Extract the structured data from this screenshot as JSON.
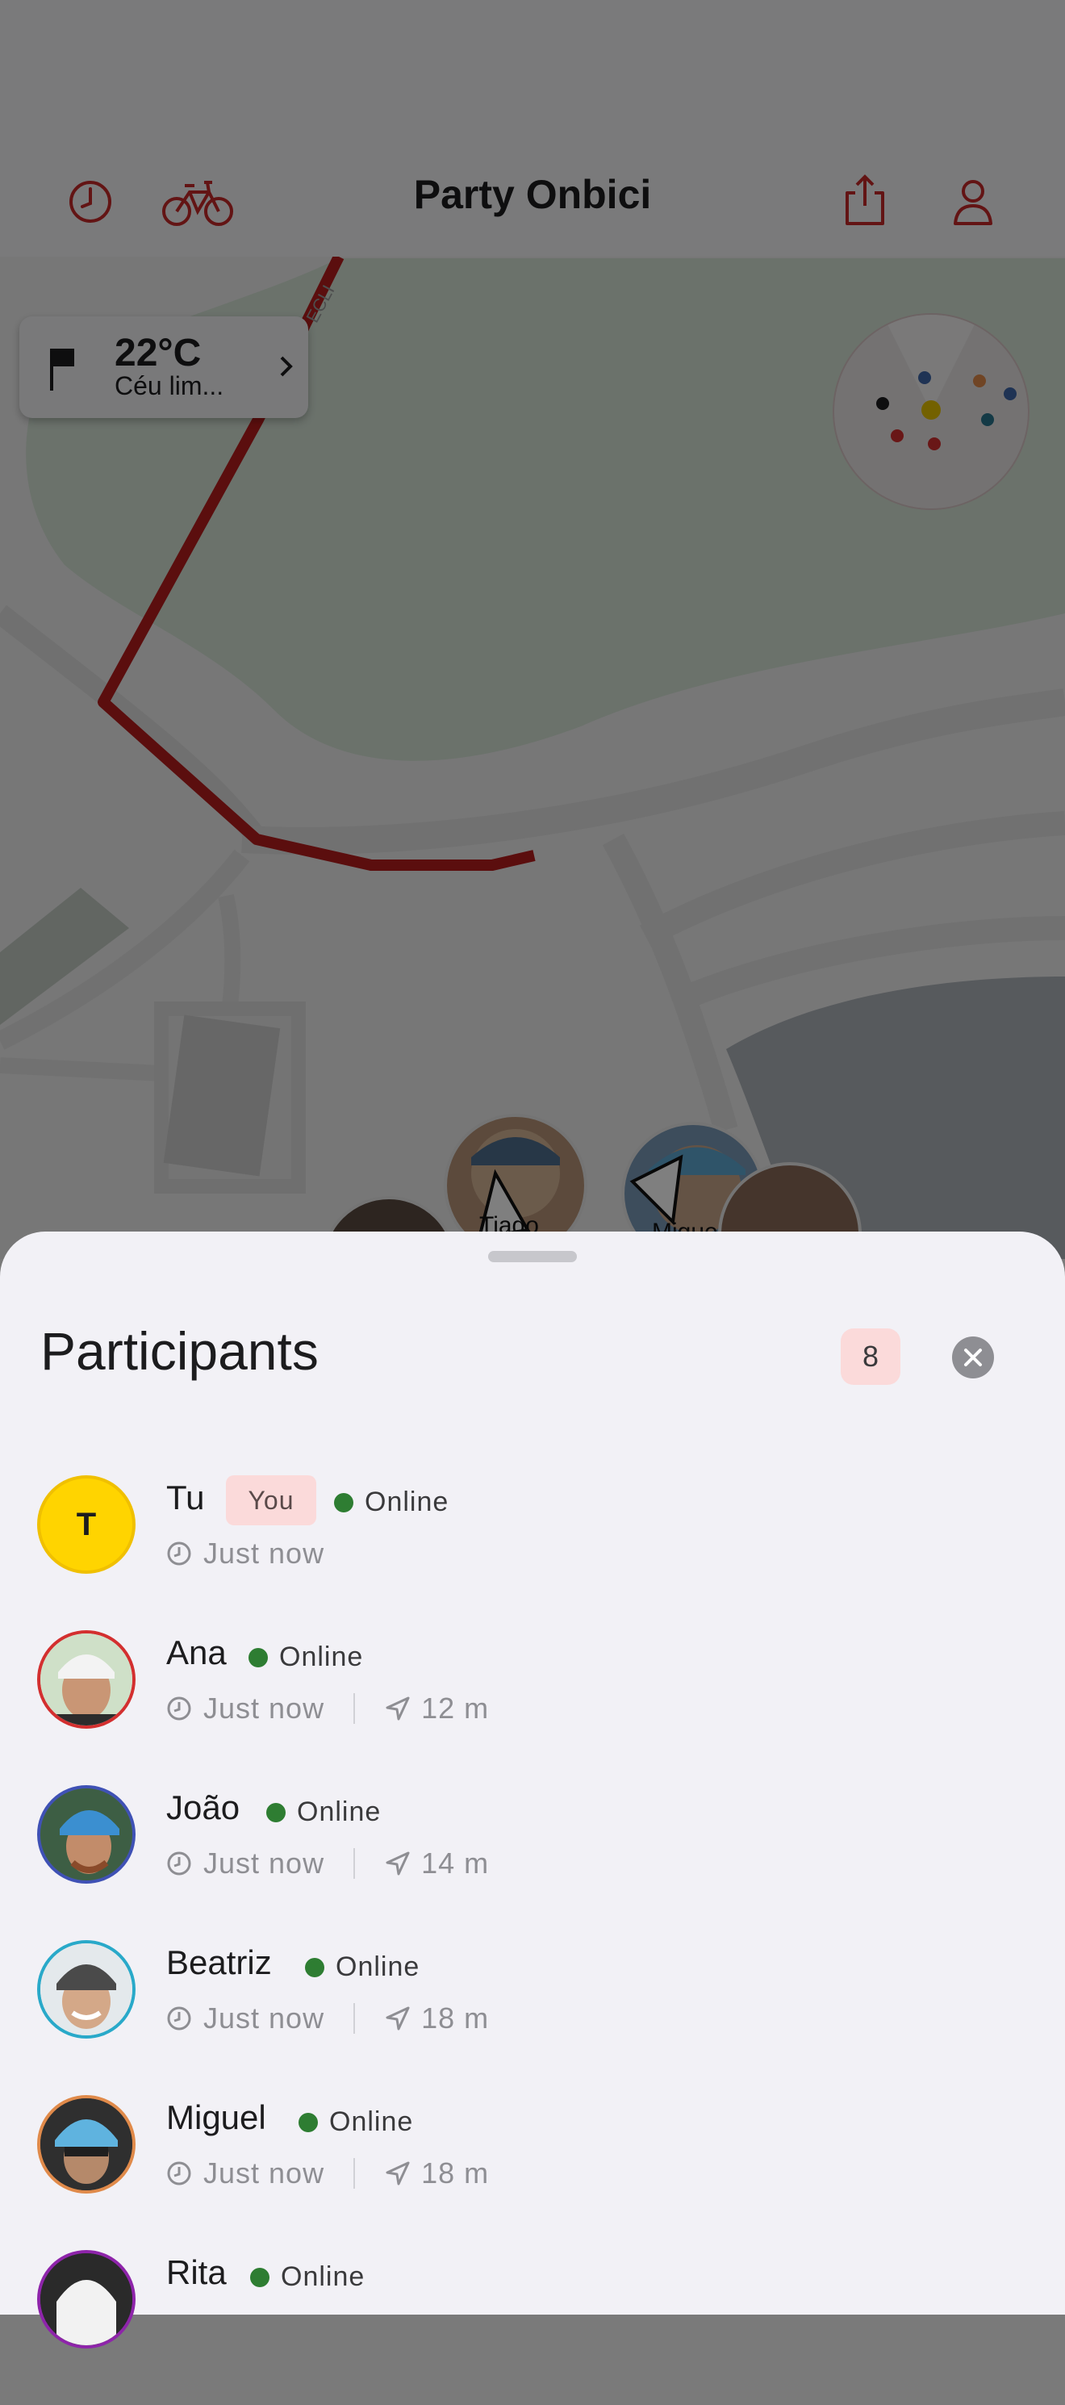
{
  "header": {
    "title": "Party Onbici",
    "history_icon": "clock-icon",
    "bike_icon": "bicycle-icon",
    "share_icon": "share-icon",
    "profile_icon": "person-icon",
    "accent_color": "#c62828"
  },
  "map": {
    "weather": {
      "temperature": "22°C",
      "description": "Céu lim..."
    },
    "rider_labels": [
      "Tiago",
      "Miguel"
    ],
    "street_label_fragment": "ECLI"
  },
  "participants": {
    "title": "Participants",
    "count": "8",
    "list": [
      {
        "name": "Tu",
        "initial": "T",
        "is_you": true,
        "you_label": "You",
        "status": "Online",
        "last_seen": "Just now",
        "distance": "",
        "ring_color": "#e6c200"
      },
      {
        "name": "Ana",
        "status": "Online",
        "last_seen": "Just now",
        "distance": "12 m",
        "ring_color": "#d32f2f"
      },
      {
        "name": "João",
        "status": "Online",
        "last_seen": "Just now",
        "distance": "14 m",
        "ring_color": "#3f51b5"
      },
      {
        "name": "Beatriz",
        "status": "Online",
        "last_seen": "Just now",
        "distance": "18 m",
        "ring_color": "#29a9c9"
      },
      {
        "name": "Miguel",
        "status": "Online",
        "last_seen": "Just now",
        "distance": "18 m",
        "ring_color": "#e08a4a"
      },
      {
        "name": "Rita",
        "status": "Online",
        "last_seen": "",
        "distance": "",
        "ring_color": "#8e24aa"
      }
    ]
  }
}
